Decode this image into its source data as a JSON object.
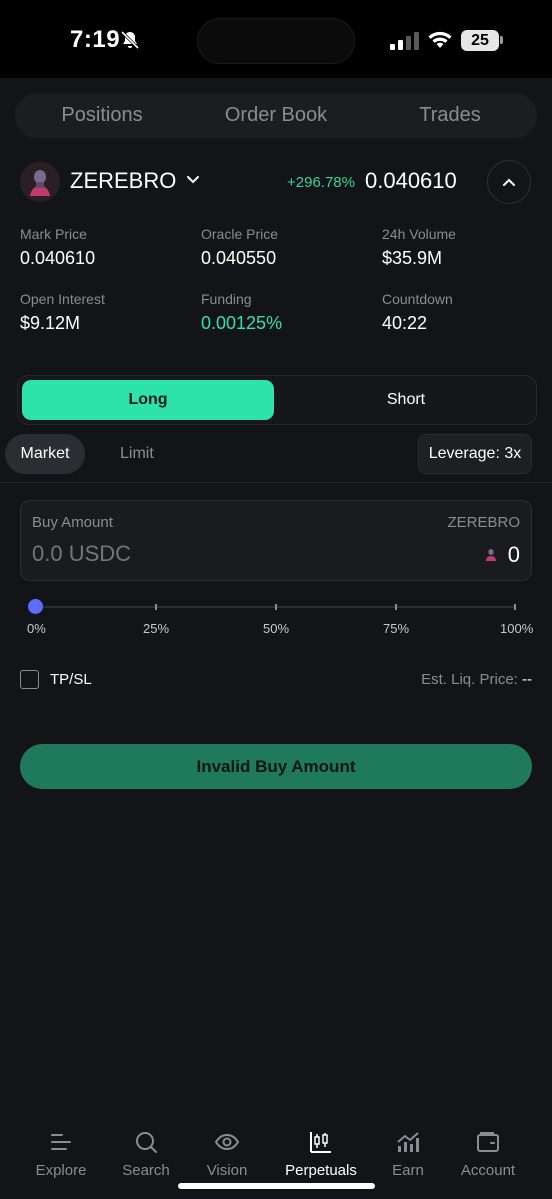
{
  "status_bar": {
    "time": "7:19",
    "battery": "25"
  },
  "top_tabs": [
    "Positions",
    "Order Book",
    "Trades"
  ],
  "market": {
    "symbol": "ZEREBRO",
    "change": "+296.78%",
    "price": "0.040610"
  },
  "stats": [
    {
      "label": "Mark Price",
      "value": "0.040610"
    },
    {
      "label": "Oracle Price",
      "value": "0.040550"
    },
    {
      "label": "24h Volume",
      "value": "$35.9M"
    },
    {
      "label": "Open Interest",
      "value": "$9.12M"
    },
    {
      "label": "Funding",
      "value": "0.00125%"
    },
    {
      "label": "Countdown",
      "value": "40:22"
    }
  ],
  "side": {
    "long": "Long",
    "short": "Short",
    "selected": "Long"
  },
  "order_type": {
    "market": "Market",
    "limit": "Limit",
    "selected": "Market",
    "leverage": "Leverage: 3x"
  },
  "amount": {
    "label": "Buy Amount",
    "token": "ZEREBRO",
    "placeholder": "0.0 USDC",
    "output": "0"
  },
  "slider": {
    "labels": [
      "0%",
      "25%",
      "50%",
      "75%",
      "100%"
    ],
    "value_percent": 0
  },
  "tpsl": {
    "label": "TP/SL",
    "checked": false
  },
  "liq_price": {
    "label": "Est. Liq. Price:",
    "value": "--"
  },
  "submit_label": "Invalid Buy Amount",
  "colors": {
    "accent_green": "#2ee3aa",
    "positive": "#35d69a",
    "submit_bg": "#1f7a5b",
    "slider_knob": "#5b6cff"
  },
  "bottom_nav": [
    {
      "label": "Explore",
      "icon": "explore-icon"
    },
    {
      "label": "Search",
      "icon": "search-icon"
    },
    {
      "label": "Vision",
      "icon": "eye-icon"
    },
    {
      "label": "Perpetuals",
      "icon": "candlestick-icon",
      "active": true
    },
    {
      "label": "Earn",
      "icon": "chart-growth-icon"
    },
    {
      "label": "Account",
      "icon": "wallet-icon"
    }
  ]
}
